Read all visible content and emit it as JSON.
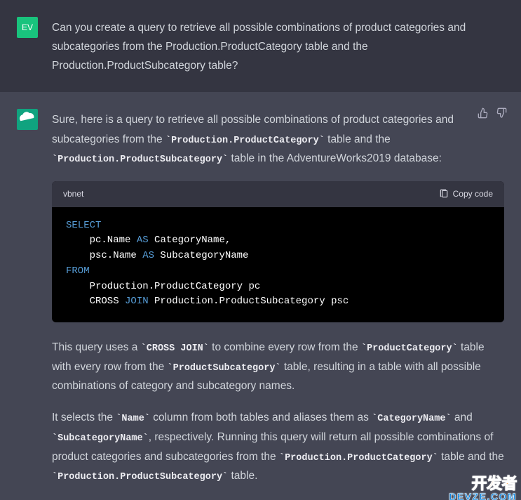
{
  "user": {
    "avatar": "EV",
    "question": "Can you create a query to retrieve all possible combinations of product categories and subcategories from the Production.ProductCategory table and the Production.ProductSubcategory table?"
  },
  "assistant": {
    "intro_pre": "Sure, here is a query to retrieve all possible combinations of product categories and subcategories from the ",
    "intro_code1": "`Production.ProductCategory`",
    "intro_mid": " table and the ",
    "intro_code2": "`Production.ProductSubcategory`",
    "intro_post": " table in the AdventureWorks2019 database:",
    "code": {
      "lang": "vbnet",
      "copy_label": "Copy code",
      "l1": "SELECT",
      "l2a": "    pc.Name ",
      "l2kw": "AS",
      "l2b": " CategoryName,",
      "l3a": "    psc.Name ",
      "l3kw": "AS",
      "l3b": " SubcategoryName",
      "l4": "FROM",
      "l5": "    Production.ProductCategory pc",
      "l6a": "    CROSS ",
      "l6kw": "JOIN",
      "l6b": " Production.ProductSubcategory psc"
    },
    "p2_a": "This query uses a ",
    "p2_c1": "`CROSS JOIN`",
    "p2_b": " to combine every row from the ",
    "p2_c2": "`ProductCategory`",
    "p2_c": " table with every row from the ",
    "p2_c3": "`ProductSubcategory`",
    "p2_d": " table, resulting in a table with all possible combinations of category and subcategory names.",
    "p3_a": "It selects the ",
    "p3_c1": "`Name`",
    "p3_b": " column from both tables and aliases them as ",
    "p3_c2": "`CategoryName`",
    "p3_c": " and ",
    "p3_c3": "`SubcategoryName`",
    "p3_d": ", respectively. Running this query will return all possible combinations of product categories and subcategories from the ",
    "p3_c4": "`Production.ProductCategory`",
    "p3_e": " table and the ",
    "p3_c5": "`Production.ProductSubcategory`",
    "p3_f": " table."
  },
  "watermark": {
    "top": "开发者",
    "bottom": "DEVZE.COM"
  }
}
